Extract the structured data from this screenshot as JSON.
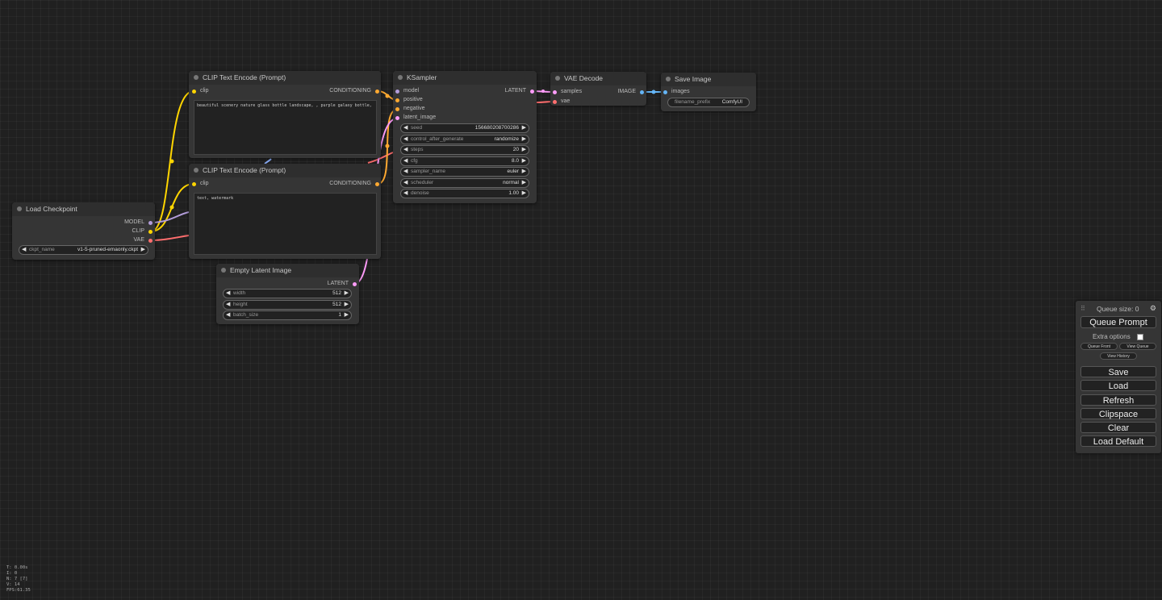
{
  "colors": {
    "clip": "#ffd500",
    "model": "#b39ddb",
    "vae": "#ff6e6e",
    "conditioning": "#ffa931",
    "latent": "#ff9cf9",
    "image": "#64b5f6"
  },
  "nodes": {
    "load_checkpoint": {
      "title": "Load Checkpoint",
      "outputs": [
        "MODEL",
        "CLIP",
        "VAE"
      ],
      "widget": {
        "label": "ckpt_name",
        "value": "v1-5-pruned-emaonly.ckpt"
      }
    },
    "clip_pos": {
      "title": "CLIP Text Encode (Prompt)",
      "input": "clip",
      "output": "CONDITIONING",
      "text": "beautiful scenery nature glass bottle landscape, , purple galaxy bottle,"
    },
    "clip_neg": {
      "title": "CLIP Text Encode (Prompt)",
      "input": "clip",
      "output": "CONDITIONING",
      "text": "text, watermark"
    },
    "ksampler": {
      "title": "KSampler",
      "inputs": [
        "model",
        "positive",
        "negative",
        "latent_image"
      ],
      "output": "LATENT",
      "widgets": [
        {
          "label": "seed",
          "value": "156680208700286"
        },
        {
          "label": "control_after_generate",
          "value": "randomize"
        },
        {
          "label": "steps",
          "value": "20"
        },
        {
          "label": "cfg",
          "value": "8.0"
        },
        {
          "label": "sampler_name",
          "value": "euler"
        },
        {
          "label": "scheduler",
          "value": "normal"
        },
        {
          "label": "denoise",
          "value": "1.00"
        }
      ]
    },
    "vae_decode": {
      "title": "VAE Decode",
      "inputs": [
        "samples",
        "vae"
      ],
      "output": "IMAGE"
    },
    "save_image": {
      "title": "Save Image",
      "input": "images",
      "widget": {
        "label": "filename_prefix",
        "value": "ComfyUI"
      }
    },
    "empty_latent": {
      "title": "Empty Latent Image",
      "output": "LATENT",
      "widgets": [
        {
          "label": "width",
          "value": "512"
        },
        {
          "label": "height",
          "value": "512"
        },
        {
          "label": "batch_size",
          "value": "1"
        }
      ]
    }
  },
  "menu": {
    "queue_size": "Queue size: 0",
    "queue_prompt": "Queue Prompt",
    "extra_options": "Extra options",
    "queue_front": "Queue Front",
    "view_queue": "View Queue",
    "view_history": "View History",
    "buttons": [
      "Save",
      "Load",
      "Refresh",
      "Clipspace",
      "Clear",
      "Load Default"
    ]
  },
  "stats": [
    "T: 0.00s",
    "I: 0",
    "N: 7 [7]",
    "V: 14",
    "FPS:61.35"
  ]
}
